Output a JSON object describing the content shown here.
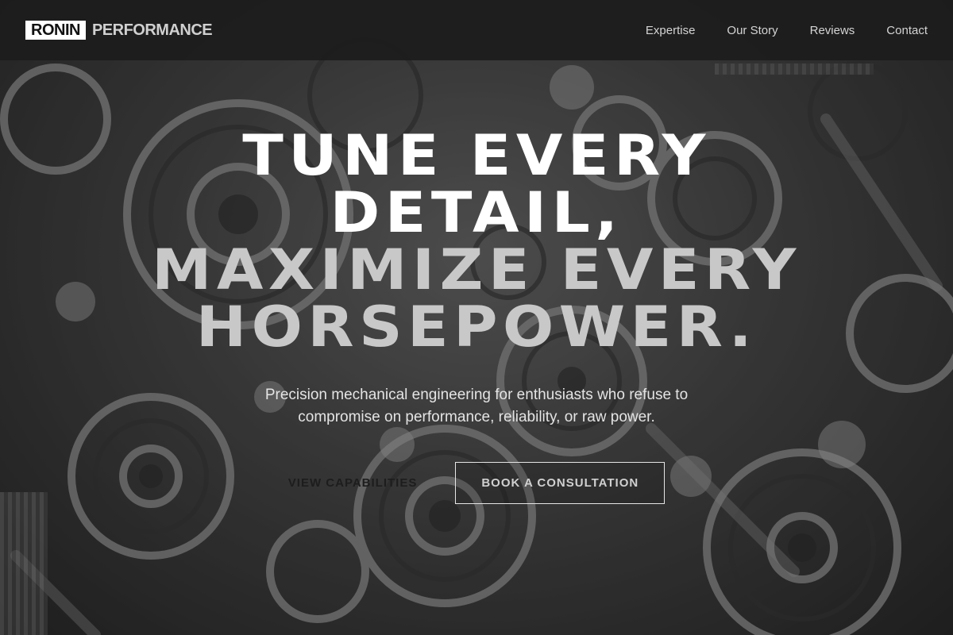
{
  "header": {
    "logo_box": "RONIN",
    "logo_rest": "PERFORMANCE",
    "nav": [
      {
        "label": "Expertise"
      },
      {
        "label": "Our Story"
      },
      {
        "label": "Reviews"
      },
      {
        "label": "Contact"
      }
    ]
  },
  "hero": {
    "headline_line1": "TUNE EVERY",
    "headline_line2": "DETAIL,",
    "headline_line3": "MAXIMIZE EVERY",
    "headline_line4": "HORSEPOWER.",
    "subtitle": "Precision mechanical engineering for enthusiasts who refuse to compromise on performance, reliability, or raw power.",
    "primary_cta": "VIEW CAPABILITIES",
    "secondary_cta": "BOOK A CONSULTATION",
    "background_image": "gears-machinery-grayscale"
  },
  "colors": {
    "header_bg": "#1c1c1c",
    "headline_primary": "#ffffff",
    "headline_secondary": "#c8c8c8"
  }
}
